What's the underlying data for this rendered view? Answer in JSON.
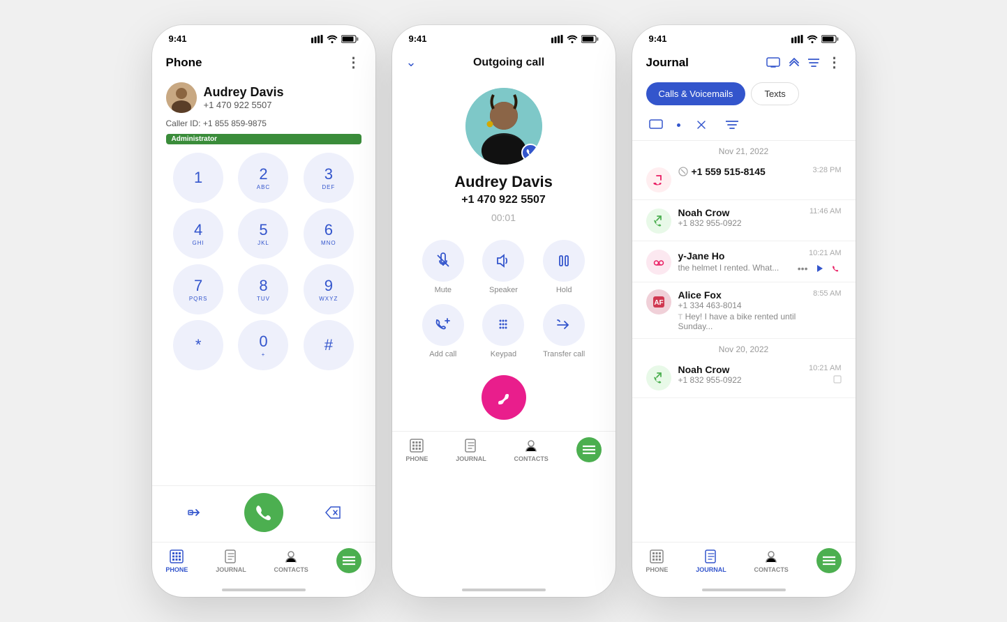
{
  "phone_screen": {
    "status_time": "9:41",
    "title": "Phone",
    "contact_name": "Audrey Davis",
    "contact_number": "+1 470 922 5507",
    "caller_id": "Caller ID: +1 855 859-9875",
    "badge": "Administrator",
    "dialpad": [
      {
        "num": "1",
        "letters": ""
      },
      {
        "num": "2",
        "letters": "ABC"
      },
      {
        "num": "3",
        "letters": "DEF"
      },
      {
        "num": "4",
        "letters": "GHI"
      },
      {
        "num": "5",
        "letters": "JKL"
      },
      {
        "num": "6",
        "letters": "MNO"
      },
      {
        "num": "7",
        "letters": "PQRS"
      },
      {
        "num": "8",
        "letters": "TUV"
      },
      {
        "num": "9",
        "letters": "WXYZ"
      },
      {
        "num": "*",
        "letters": ""
      },
      {
        "num": "0",
        "letters": "+"
      },
      {
        "num": "#",
        "letters": ""
      }
    ],
    "nav_items": [
      {
        "label": "PHONE",
        "active": true
      },
      {
        "label": "JOURNAL",
        "active": false
      },
      {
        "label": "CONTACTS",
        "active": false
      }
    ]
  },
  "outgoing_screen": {
    "status_time": "9:41",
    "header": "Outgoing call",
    "contact_name": "Audrey Davis",
    "contact_number": "+1 470 922 5507",
    "timer": "00:01",
    "controls": [
      {
        "icon": "mute",
        "label": "Mute"
      },
      {
        "icon": "speaker",
        "label": "Speaker"
      },
      {
        "icon": "hold",
        "label": "Hold"
      },
      {
        "icon": "add_call",
        "label": "Add call"
      },
      {
        "icon": "keypad",
        "label": "Keypad"
      },
      {
        "icon": "transfer",
        "label": "Transfer call"
      }
    ],
    "nav_items": [
      {
        "label": "PHONE",
        "active": false
      },
      {
        "label": "JOURNAL",
        "active": false
      },
      {
        "label": "CONTACTS",
        "active": false
      }
    ]
  },
  "journal_screen": {
    "status_time": "9:41",
    "title": "Journal",
    "tabs": [
      {
        "label": "Calls & Voicemails",
        "active": true
      },
      {
        "label": "Texts",
        "active": false
      }
    ],
    "dates": {
      "date1": "Nov 21, 2022",
      "date2": "Nov 20, 2022"
    },
    "entries": [
      {
        "type": "missed",
        "name": "+1 559 515-8145",
        "number": "",
        "time": "3:28 PM",
        "preview": ""
      },
      {
        "type": "outgoing",
        "name": "Noah Crow",
        "number": "+1 832 955-0922",
        "time": "11:46 AM",
        "preview": ""
      },
      {
        "type": "voicemail",
        "name": "y-Jane Ho",
        "number": "",
        "time": "10:21 AM",
        "preview": "the helmet I rented. What..."
      },
      {
        "type": "voicemail_contact",
        "name": "Alice Fox",
        "number": "+1 334 463-8014",
        "time": "8:55 AM",
        "preview": "Hey! I have a bike rented until Sunday..."
      },
      {
        "type": "outgoing",
        "name": "Noah Crow",
        "number": "+1 832 955-0922",
        "time": "10:21 AM",
        "preview": ""
      }
    ],
    "nav_items": [
      {
        "label": "PHONE",
        "active": false
      },
      {
        "label": "JOURNAL",
        "active": true
      },
      {
        "label": "CONTACTS",
        "active": false
      }
    ]
  }
}
